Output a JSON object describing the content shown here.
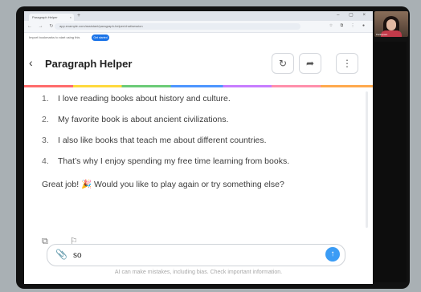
{
  "browser": {
    "tab_title": "Paragraph Helper",
    "tab_close": "×",
    "new_tab": "+",
    "window_controls": "– ▢ ×",
    "nav_buttons": "← → ↻",
    "url": "app.example.com/assistant/paragraph-helper/chat/session",
    "address_icons": "☆ ⧉ ⋮ ●",
    "bookmarks_text": "Import bookmarks to start using this",
    "bookmarks_pill": "Get started"
  },
  "header": {
    "back": "‹",
    "title": "Paragraph Helper",
    "refresh_icon": "↻",
    "share_icon": "➦",
    "more_icon": "⋮"
  },
  "chat": {
    "list_items": [
      {
        "num": "1.",
        "text": "I love reading books about history and culture."
      },
      {
        "num": "2.",
        "text": "My favorite book is about ancient civilizations."
      },
      {
        "num": "3.",
        "text": "I also like books that teach me about different countries."
      },
      {
        "num": "4.",
        "text": "That’s why I enjoy spending my free time learning from books."
      }
    ],
    "reply_before": "Great job! ",
    "reply_emoji": "🎉",
    "reply_after": " Would you like to play again or try something else?",
    "msg_icons": "⧉ ⚐"
  },
  "input": {
    "attach_icon": "📎",
    "value": "so",
    "send_icon": "↑"
  },
  "disclaimer": "AI can make mistakes, including bias. Check important information.",
  "webcam": {
    "label": "Participant"
  },
  "colors": {
    "accent": "#3b9cf5",
    "frame": "#111111"
  }
}
